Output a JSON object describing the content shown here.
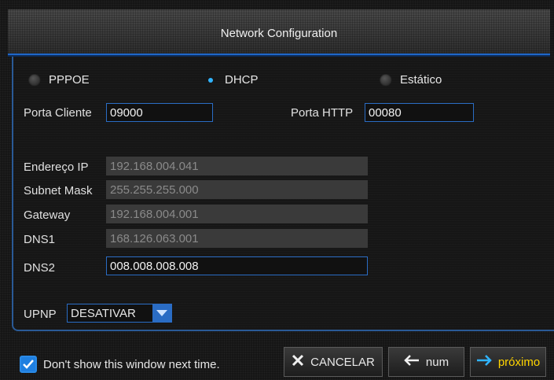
{
  "window": {
    "title": "Network Configuration"
  },
  "mode": {
    "options": [
      {
        "label": "PPPOE",
        "selected": false
      },
      {
        "label": "DHCP",
        "selected": true
      },
      {
        "label": "Estático",
        "selected": false
      }
    ]
  },
  "ports": {
    "client_label": "Porta Cliente",
    "client_value": "09000",
    "http_label": "Porta HTTP",
    "http_value": "00080"
  },
  "network": {
    "ip_label": "Endereço IP",
    "ip_value": "192.168.004.041",
    "mask_label": "Subnet Mask",
    "mask_value": "255.255.255.000",
    "gateway_label": "Gateway",
    "gateway_value": "192.168.004.001",
    "dns1_label": "DNS1",
    "dns1_value": "168.126.063.001",
    "dns2_label": "DNS2",
    "dns2_value": "008.008.008.008"
  },
  "upnp": {
    "label": "UPNP",
    "value": "DESATIVAR"
  },
  "footer": {
    "dont_show_label": "Don't show this window next time.",
    "dont_show_checked": true,
    "cancel_label": "CANCELAR",
    "prev_label": "num",
    "next_label": "próximo"
  },
  "colors": {
    "accent": "#2a6cc4",
    "selected_dot": "#30b4ff",
    "next_text": "#ffd400"
  },
  "icons": {
    "cancel": "x-icon",
    "prev": "arrow-left-icon",
    "next": "arrow-right-icon",
    "dropdown": "chevron-down-icon",
    "check": "checkmark-icon"
  }
}
